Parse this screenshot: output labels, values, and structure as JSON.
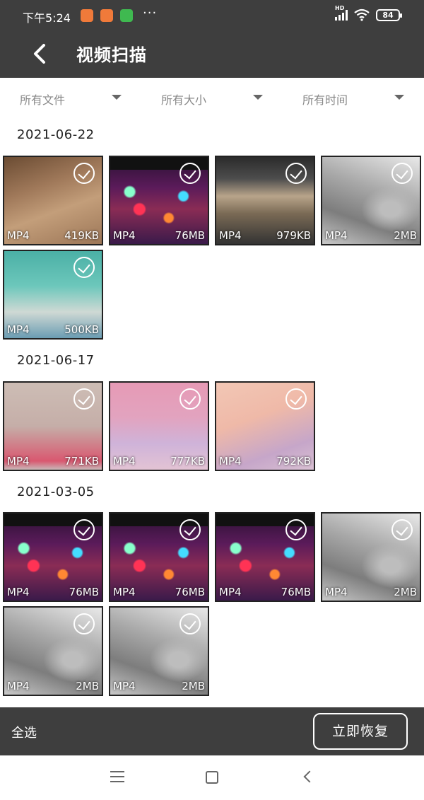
{
  "status_bar": {
    "time": "下午5:24",
    "network_label": "HD",
    "battery": "84",
    "more_indicator": "···"
  },
  "header": {
    "title": "视频扫描",
    "back_icon": "chevron-left-icon"
  },
  "filters": [
    {
      "label": "所有文件"
    },
    {
      "label": "所有大小"
    },
    {
      "label": "所有时间"
    }
  ],
  "groups": [
    {
      "date": "2021-06-22",
      "videos": [
        {
          "format": "MP4",
          "size": "419KB"
        },
        {
          "format": "MP4",
          "size": "76MB"
        },
        {
          "format": "MP4",
          "size": "979KB"
        },
        {
          "format": "MP4",
          "size": "2MB"
        },
        {
          "format": "MP4",
          "size": "500KB"
        }
      ]
    },
    {
      "date": "2021-06-17",
      "videos": [
        {
          "format": "MP4",
          "size": "771KB"
        },
        {
          "format": "MP4",
          "size": "777KB"
        },
        {
          "format": "MP4",
          "size": "792KB"
        }
      ]
    },
    {
      "date": "2021-03-05",
      "videos": [
        {
          "format": "MP4",
          "size": "76MB"
        },
        {
          "format": "MP4",
          "size": "76MB"
        },
        {
          "format": "MP4",
          "size": "76MB"
        },
        {
          "format": "MP4",
          "size": "2MB"
        },
        {
          "format": "MP4",
          "size": "2MB"
        },
        {
          "format": "MP4",
          "size": "2MB"
        }
      ]
    }
  ],
  "bottom_bar": {
    "select_all": "全选",
    "recover_button": "立即恢复"
  },
  "colors": {
    "bar_background": "#3e3e3e",
    "page_background": "#ffffff"
  }
}
